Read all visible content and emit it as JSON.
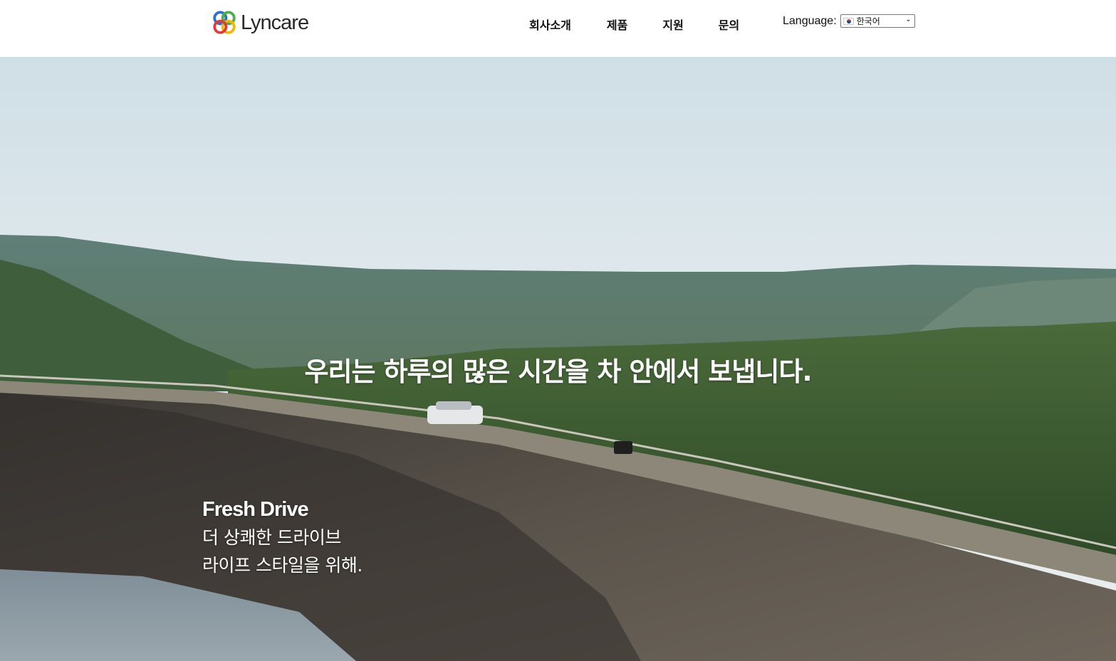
{
  "brand": {
    "name": "Lyncare",
    "logo_icon": "interlinked-rings-icon"
  },
  "nav": {
    "items": [
      {
        "label": "회사소개"
      },
      {
        "label": "제품"
      },
      {
        "label": "지원"
      },
      {
        "label": "문의"
      }
    ]
  },
  "language": {
    "label": "Language:",
    "selected": "한국어",
    "flag_icon": "korea-flag-icon"
  },
  "hero": {
    "headline": "우리는 하루의 많은 시간을 차 안에서 보냅니다.",
    "sub_title": "Fresh Drive",
    "sub_line_1": "더 상쾌한 드라이브",
    "sub_line_2": "라이프 스타일을 위해."
  },
  "colors": {
    "logo_blue": "#2f6fd0",
    "logo_green": "#4cae4f",
    "logo_yellow": "#f2b705",
    "logo_red": "#e0393e"
  }
}
